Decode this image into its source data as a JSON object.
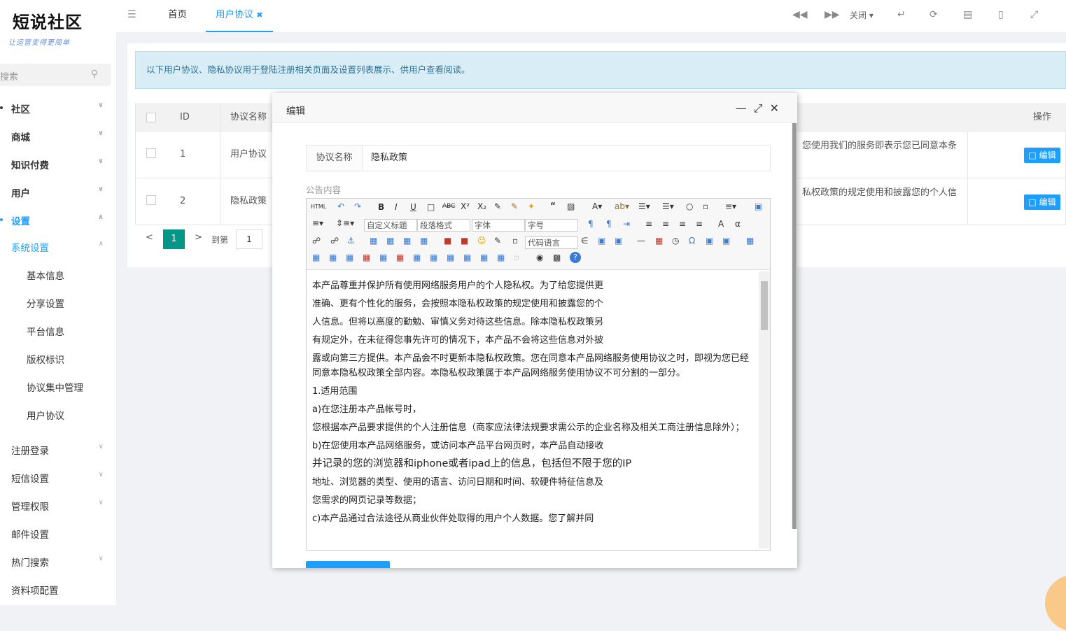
{
  "logo": {
    "title": "短说社区",
    "subtitle": "让运营变得更简单"
  },
  "sidebar": {
    "search_placeholder": "搜索",
    "items": [
      {
        "label": "社区"
      },
      {
        "label": "商城"
      },
      {
        "label": "知识付费"
      },
      {
        "label": "用户"
      },
      {
        "label": "设置"
      },
      {
        "label": "系统设置"
      },
      {
        "label": "基本信息"
      },
      {
        "label": "分享设置"
      },
      {
        "label": "平台信息"
      },
      {
        "label": "版权标识"
      },
      {
        "label": "协议集中管理"
      },
      {
        "label": "用户协议"
      },
      {
        "label": "注册登录"
      },
      {
        "label": "短信设置"
      },
      {
        "label": "管理权限"
      },
      {
        "label": "邮件设置"
      },
      {
        "label": "热门搜索"
      },
      {
        "label": "资料项配置"
      }
    ]
  },
  "topbar": {
    "tabs": [
      {
        "label": "首页"
      },
      {
        "label": "用户协议"
      }
    ],
    "close_label": "关闭"
  },
  "notice": "以下用户协议、隐私协议用于登陆注册相关页面及设置列表展示、供用户查看阅读。",
  "table": {
    "headers": {
      "id": "ID",
      "name": "协议名称",
      "ops": "操作"
    },
    "rows": [
      {
        "id": "1",
        "name": "用户协议",
        "content": "您使用我们的服务即表示您已同意本条",
        "edit": "编辑"
      },
      {
        "id": "2",
        "name": "隐私政策",
        "content": "私权政策的规定使用和披露您的个人信",
        "edit": "编辑"
      }
    ]
  },
  "pager": {
    "page": "1",
    "goto": "到第",
    "input": "1"
  },
  "dialog": {
    "title": "编辑",
    "field_label": "协议名称",
    "field_value": "隐私政策",
    "content_label": "公告内容",
    "toolbar": {
      "custom_title": "自定义标题",
      "paragraph": "段落格式",
      "font": "字体",
      "size": "字号",
      "code": "代码语言"
    },
    "paragraphs": [
      "本产品尊重并保护所有使用网络服务用户的个人隐私权。为了给您提供更",
      "准确、更有个性化的服务，会按照本隐私权政策的规定使用和披露您的个",
      "人信息。但将以高度的勤勉、审慎义务对待这些信息。除本隐私权政策另",
      "有规定外，在未征得您事先许可的情况下，本产品不会将这些信息对外披",
      "露或向第三方提供。本产品会不时更新本隐私权政策。您在同意本产品网络服务使用协议之时，即视为您已经同意本隐私权政策全部内容。本隐私权政策属于本产品网络服务使用协议不可分割的一部分。",
      "1.适用范围",
      "a)在您注册本产品帐号时，",
      "您根据本产品要求提供的个人注册信息（商家应法律法规要求需公示的企业名称及相关工商注册信息除外）；",
      "b)在您使用本产品网络服务，或访问本产品平台网页时，本产品自动接收",
      "并记录的您的浏览器和iphone或者ipad上的信息，包括但不限于您的IP",
      "地址、浏览器的类型、使用的语言、访问日期和时间、软硬件特征信息及",
      "您需求的网页记录等数据；",
      "c)本产品通过合法途径从商业伙伴处取得的用户个人数据。您了解并同"
    ]
  },
  "colors": {
    "accent": "#1e9fff",
    "notice_bg": "#d9edf7",
    "pager_active": "#009688"
  }
}
